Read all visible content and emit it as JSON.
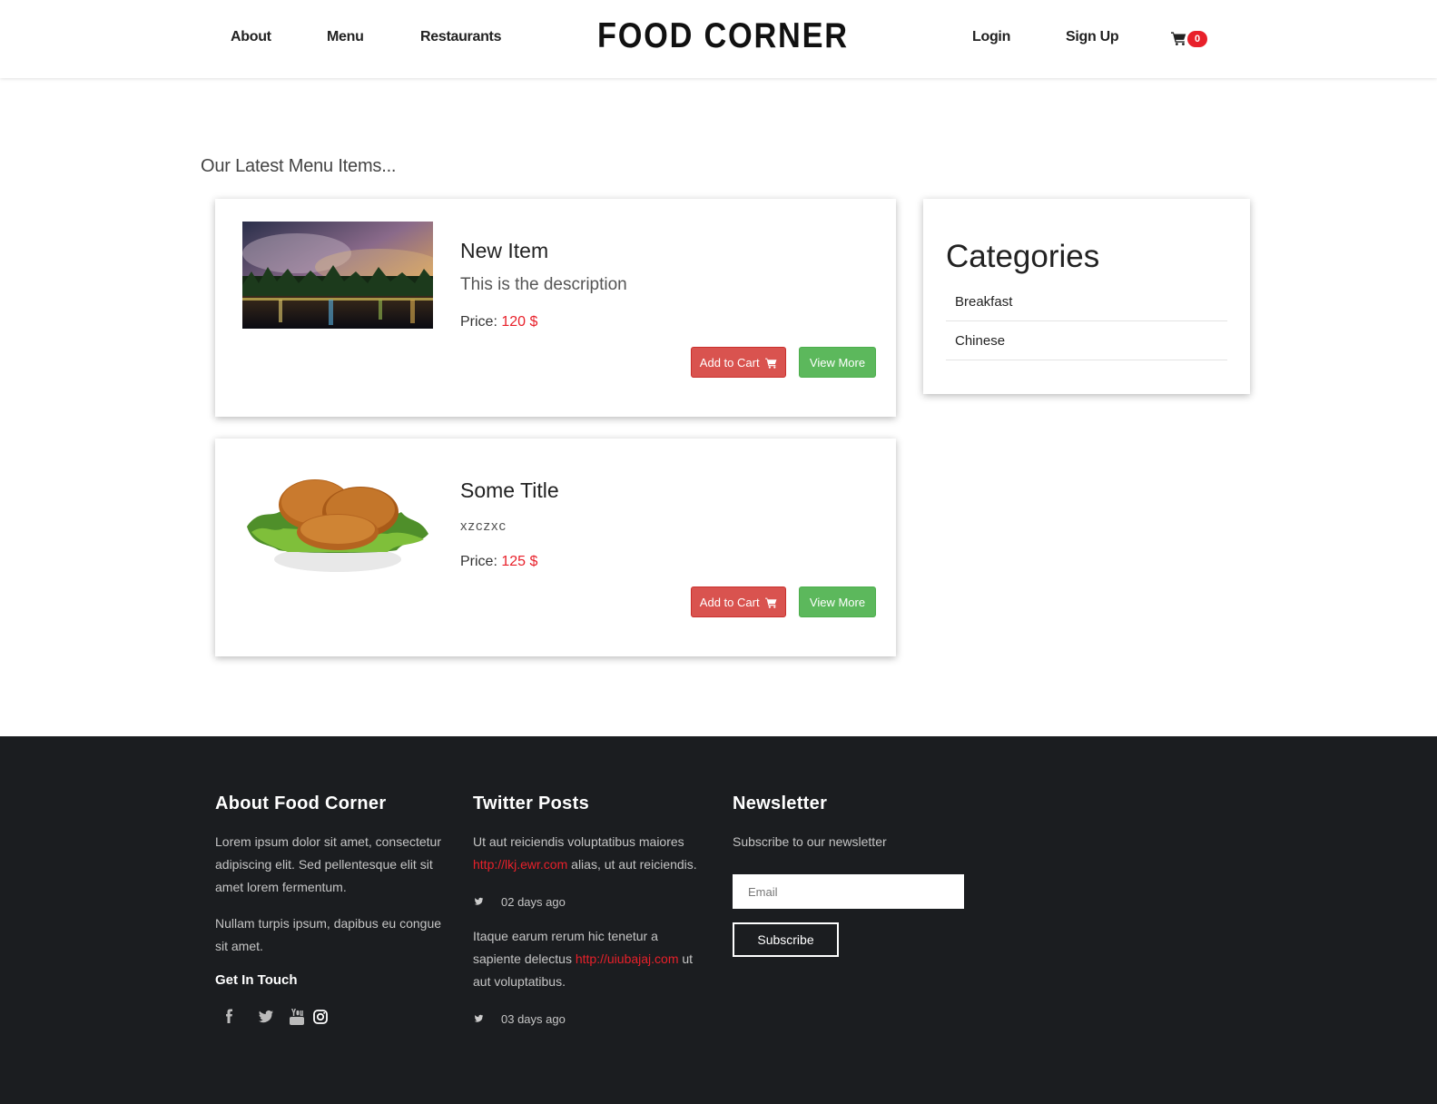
{
  "header": {
    "nav_left": [
      "About",
      "Menu",
      "Restaurants"
    ],
    "brand": "FOOD CORNER",
    "nav_right": [
      "Login",
      "Sign Up"
    ],
    "cart_count": "0"
  },
  "main": {
    "section_title": "Our Latest Menu Items...",
    "items": [
      {
        "title": "New Item",
        "description": "This is the description",
        "price_label": "Price:",
        "price_value": "120 $",
        "add_to_cart_label": "Add to Cart",
        "view_more_label": "View More"
      },
      {
        "title": "Some Title",
        "description": "xzczxc",
        "price_label": "Price:",
        "price_value": "125 $",
        "add_to_cart_label": "Add to Cart",
        "view_more_label": "View More"
      }
    ]
  },
  "categories": {
    "title": "Categories",
    "items": [
      "Breakfast",
      "Chinese"
    ]
  },
  "footer": {
    "about": {
      "heading": "About Food Corner",
      "paragraph1": "Lorem ipsum dolor sit amet, consectetur adipiscing elit. Sed pellentesque elit sit amet lorem fermentum.",
      "paragraph2": "Nullam turpis ipsum, dapibus eu congue sit amet.",
      "get_in_touch": "Get In Touch",
      "social_icons": [
        "facebook-icon",
        "twitter-icon",
        "youtube-icon",
        "instagram-icon"
      ]
    },
    "twitter": {
      "heading": "Twitter Posts",
      "posts": [
        {
          "text_before": "Ut aut reiciendis voluptatibus maiores",
          "link": "http://lkj.ewr.com",
          "text_after": "alias, ut aut reiciendis.",
          "time": "02 days ago"
        },
        {
          "text_before": "Itaque earum rerum hic tenetur a sapiente delectus",
          "link": "http://uiubajaj.com",
          "text_after": "ut aut voluptatibus.",
          "time": "03 days ago"
        }
      ]
    },
    "newsletter": {
      "heading": "Newsletter",
      "text": "Subscribe to our newsletter",
      "email_placeholder": "Email",
      "subscribe_label": "Subscribe"
    }
  },
  "colors": {
    "accent_red": "#e8202a",
    "btn_red": "#d9534f",
    "btn_green": "#5cb85c",
    "footer_bg": "#1b1d20"
  }
}
